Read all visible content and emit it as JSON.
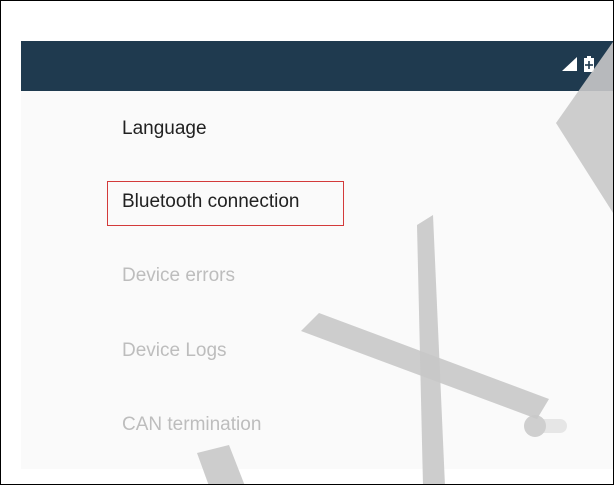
{
  "status_bar": {
    "icons": [
      "signal-icon",
      "battery-charging-icon"
    ],
    "background_color": "#1f3a4f"
  },
  "settings": {
    "items": [
      {
        "label": "Language",
        "enabled": true
      },
      {
        "label": "Bluetooth connection",
        "enabled": true,
        "highlighted": true
      },
      {
        "label": "Device errors",
        "enabled": false
      },
      {
        "label": "Device Logs",
        "enabled": false
      },
      {
        "label": "CAN termination",
        "enabled": false,
        "toggle": {
          "on": false
        }
      }
    ]
  },
  "colors": {
    "highlight_border": "#d33a3a",
    "disabled_text": "#bdbdbd",
    "enabled_text": "#212121",
    "watermark": "#c8c8c8"
  }
}
